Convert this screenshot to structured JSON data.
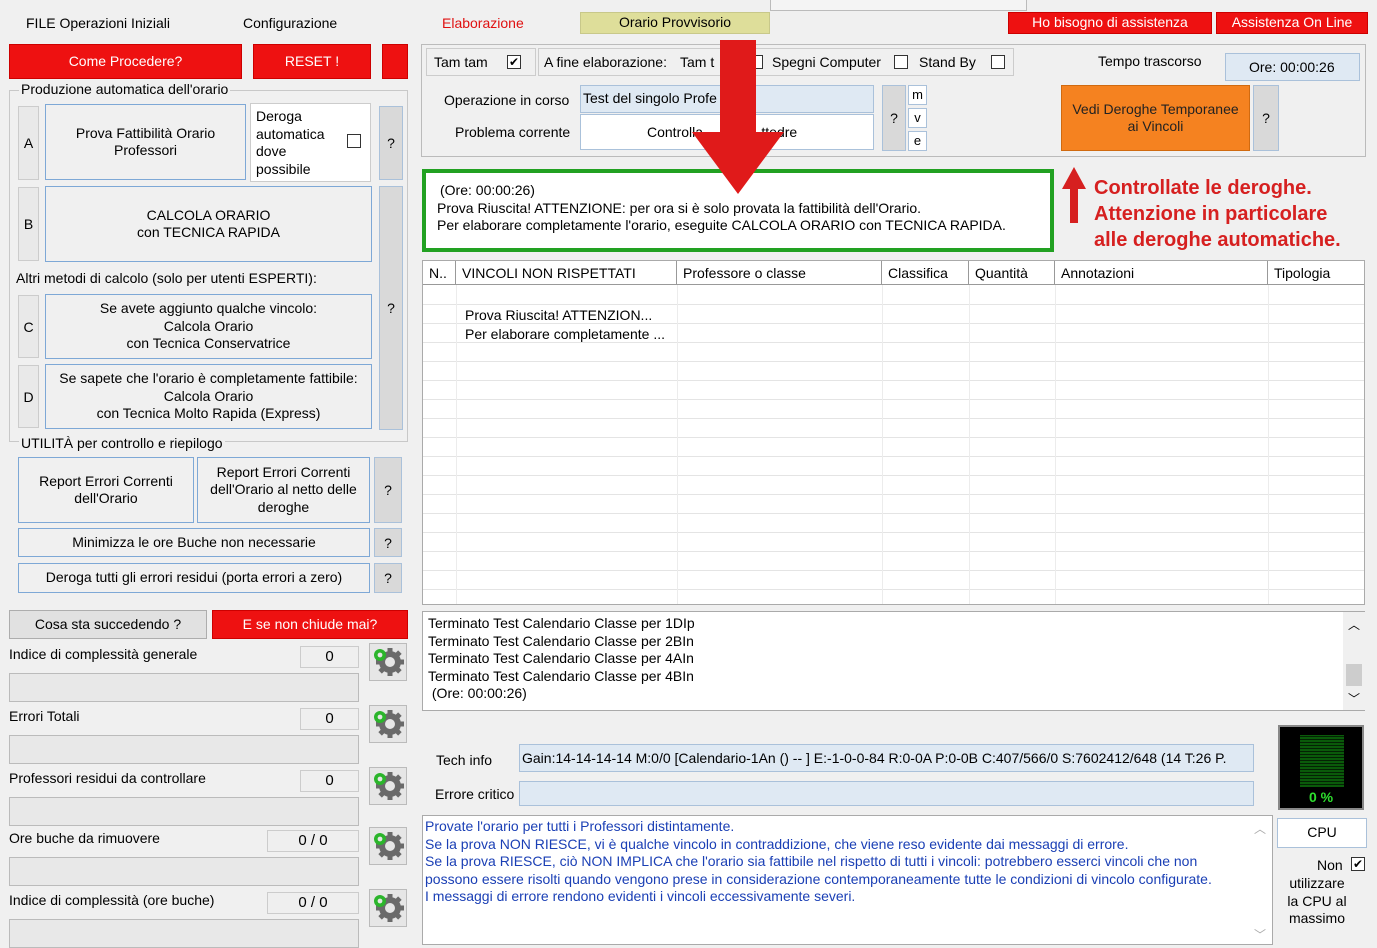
{
  "menu": {
    "file": "FILE Operazioni Iniziali",
    "config": "Configurazione",
    "elaborazione": "Elaborazione",
    "orario": "Orario Provvisorio",
    "help": "Ho bisogno di assistenza",
    "online": "Assistenza On Line"
  },
  "left": {
    "come": "Come Procedere?",
    "reset": "RESET !",
    "produzione_title": "Produzione automatica dell'orario",
    "a_letter": "A",
    "a_label": "Prova Fattibilità Orario Professori",
    "deroga_label": "Deroga automatica dove possibile",
    "b_letter": "B",
    "b_label": "CALCOLA ORARIO\ncon TECNICA RAPIDA",
    "altri": "Altri metodi di calcolo (solo per utenti ESPERTI):",
    "c_letter": "C",
    "c_label": "Se avete aggiunto qualche vincolo:\nCalcola Orario\ncon Tecnica Conservatrice",
    "d_letter": "D",
    "d_label": "Se sapete che l'orario è completamente fattibile:\nCalcola Orario\ncon Tecnica Molto Rapida (Express)",
    "utilita_title": "UTILITÀ per controllo e riepilogo",
    "report1": "Report Errori Correnti\ndell'Orario",
    "report2": "Report Errori Correnti\ndell'Orario al netto delle\nderoghe",
    "minimizza": "Minimizza le ore Buche non necessarie",
    "deroga_tutti": "Deroga tutti gli errori residui (porta errori a zero)",
    "q": "?",
    "cosa": "Cosa sta succedendo ?",
    "chiude": "E se non chiude mai?",
    "stats": [
      {
        "label": "Indice di complessità generale",
        "value": "0"
      },
      {
        "label": "Errori Totali",
        "value": "0"
      },
      {
        "label": "Professori residui da controllare",
        "value": "0"
      },
      {
        "label": "Ore buche da rimuovere",
        "value": "0 / 0"
      },
      {
        "label": "Indice di complessità (ore buche)",
        "value": "0 / 0"
      }
    ]
  },
  "top": {
    "tamtam": "Tam tam",
    "fine": "A fine elaborazione:",
    "tamt": "Tam t",
    "spegni": "Spegni Computer",
    "standby": "Stand By",
    "tempo_label": "Tempo trascorso",
    "tempo_value": "Ore: 00:00:26",
    "operazione_label": "Operazione in corso",
    "operazione_value": "Test del singolo Profe",
    "problema_label": "Problema corrente",
    "problema_value": "Controlla               ttedre",
    "m": "m",
    "v": "v",
    "e": "e",
    "deroghe_btn": "Vedi Deroghe Temporanee\nai Vincoli"
  },
  "message": {
    "line1": "(Ore: 00:00:26)",
    "line2": "Prova Riuscita! ATTENZIONE: per ora si è solo provata la fattibilità dell'Orario.",
    "line3": "Per elaborare completamente l'orario, eseguite CALCOLA ORARIO con TECNICA RAPIDA."
  },
  "annotation": {
    "line1": "Controllate le deroghe.",
    "line2": "Attenzione in particolare",
    "line3": "alle deroghe automatiche.",
    "color": "#d62020"
  },
  "table": {
    "headers": [
      "N..",
      "VINCOLI NON RISPETTATI",
      "Professore o classe",
      "Classifica",
      "Quantità",
      "Annotazioni",
      "Tipologia"
    ],
    "rows": [
      "Prova Riuscita! ATTENZION...",
      "Per elaborare completamente ..."
    ]
  },
  "log": [
    "Terminato Test Calendario Classe per 1DIp",
    "Terminato Test Calendario Classe per 2BIn",
    "Terminato Test Calendario Classe per 4AIn",
    "Terminato Test Calendario Classe per 4BIn",
    " (Ore: 00:00:26)"
  ],
  "tech": {
    "label": "Tech info",
    "value": "Gain:14-14-14-14 M:0/0 [Calendario-1An () -- ] E:-1-0-0-84 R:0-0A P:0-0B C:407/566/0 S:7602412/648 (14 T:26 P.",
    "errore_label": "Errore critico"
  },
  "cpu": {
    "percent": "0 %",
    "btn": "CPU",
    "non": "Non",
    "text": "utilizzare\nla CPU al\nmassimo"
  },
  "info": [
    "Provate l'orario per tutti i Professori distintamente.",
    "Se la prova NON RIESCE, vi è qualche vincolo in contraddizione, che viene reso evidente dai messaggi di errore.",
    "Se la prova RIESCE, ciò NON IMPLICA che l'orario sia fattibile nel rispetto di tutti i vincoli: potrebbero esserci vincoli che non",
    "possono essere risolti quando vengono prese in considerazione contemporaneamente tutte le condizioni di vincolo configurate.",
    "I messaggi di errore rendono evidenti i vincoli eccessivamente severi."
  ]
}
